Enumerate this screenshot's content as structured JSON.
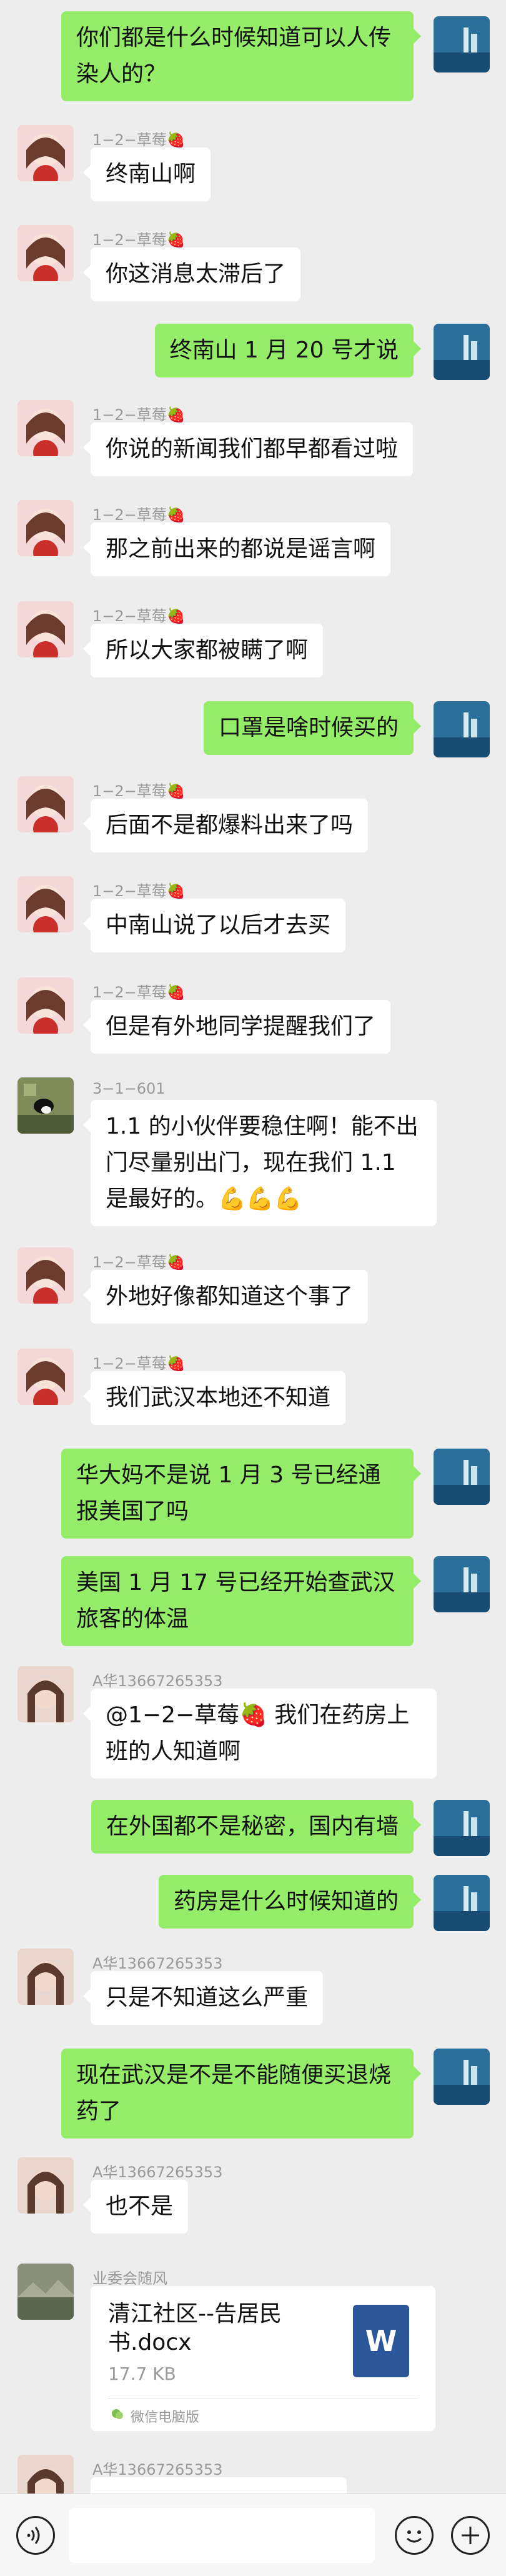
{
  "messages": [
    {
      "dir": "out",
      "text": "你们都是什么时候知道可以人传染人的？"
    },
    {
      "dir": "in",
      "sender": "1−2−草莓🍓",
      "text": "终南山啊"
    },
    {
      "dir": "in",
      "sender": "1−2−草莓🍓",
      "text": "你这消息太滞后了"
    },
    {
      "dir": "out",
      "text": "终南山 1 月 20 号才说"
    },
    {
      "dir": "in",
      "sender": "1−2−草莓🍓",
      "text": "你说的新闻我们都早都看过啦"
    },
    {
      "dir": "in",
      "sender": "1−2−草莓🍓",
      "text": "那之前出来的都说是谣言啊"
    },
    {
      "dir": "in",
      "sender": "1−2−草莓🍓",
      "text": "所以大家都被瞒了啊"
    },
    {
      "dir": "out",
      "text": "口罩是啥时候买的"
    },
    {
      "dir": "in",
      "sender": "1−2−草莓🍓",
      "text": "后面不是都爆料出来了吗"
    },
    {
      "dir": "in",
      "sender": "1−2−草莓🍓",
      "text": "中南山说了以后才去买"
    },
    {
      "dir": "in",
      "sender": "1−2−草莓🍓",
      "text": "但是有外地同学提醒我们了"
    },
    {
      "dir": "in",
      "sender": "3−1−601",
      "text": "1.1 的小伙伴要稳住啊！能不出门尽量别出门，现在我们 1.1 是最好的。💪💪💪"
    },
    {
      "dir": "in",
      "sender": "1−2−草莓🍓",
      "text": "外地好像都知道这个事了"
    },
    {
      "dir": "in",
      "sender": "1−2−草莓🍓",
      "text": "我们武汉本地还不知道"
    },
    {
      "dir": "out",
      "text": "华大妈不是说 1 月 3 号已经通报美国了吗"
    },
    {
      "dir": "out",
      "text": "美国 1 月 17 号已经开始查武汉旅客的体温"
    },
    {
      "dir": "in",
      "sender": "A华13667265353",
      "text": "@1−2−草莓🍓 我们在药房上班的人知道啊"
    },
    {
      "dir": "out",
      "text": "在外国都不是秘密，国内有墙"
    },
    {
      "dir": "out",
      "text": "药房是什么时候知道的"
    },
    {
      "dir": "in",
      "sender": "A华13667265353",
      "text": "只是不知道这么严重"
    },
    {
      "dir": "out",
      "text": "现在武汉是不是不能随便买退烧药了"
    },
    {
      "dir": "in",
      "sender": "A华13667265353",
      "text": "也不是"
    },
    {
      "dir": "in",
      "sender": "业委会随风",
      "file": {
        "name": "清江社区--告居民书.docx",
        "size": "17.7 KB",
        "source": "微信电脑版",
        "icon": "W"
      }
    },
    {
      "dir": "in",
      "sender": "A华13667265353",
      "text": ""
    }
  ],
  "colors": {
    "out_bubble": "#95ec69",
    "in_bubble": "#ffffff",
    "background": "#ededed"
  },
  "icons": [
    "voice-icon",
    "emoji-icon",
    "plus-icon"
  ]
}
